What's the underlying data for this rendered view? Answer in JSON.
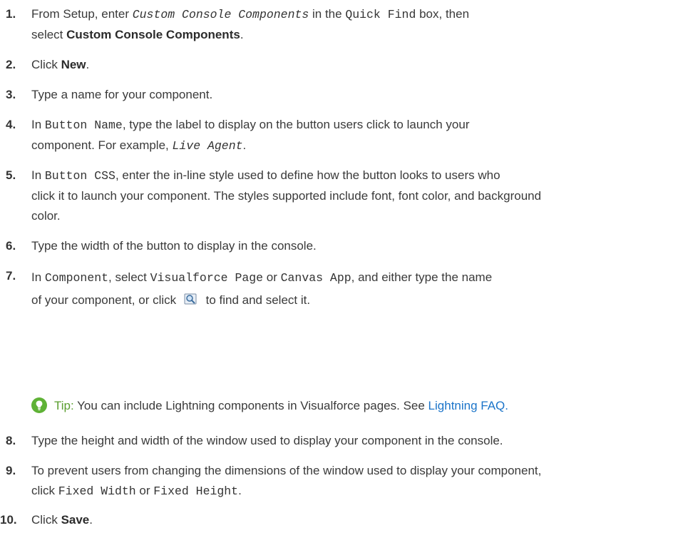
{
  "steps": [
    {
      "num": "1.",
      "a": "From Setup, enter ",
      "c1": "Custom Console Components",
      "b": " in the ",
      "c2": "Quick Find",
      "d": " box, then",
      "line2a": "select ",
      "bold": "Custom Console Components",
      "line2b": "."
    },
    {
      "num": "2.",
      "a": "Click ",
      "bold": "New",
      "b": "."
    },
    {
      "num": "3.",
      "a": "Type a name for your component."
    },
    {
      "num": "4.",
      "a": "In ",
      "c1": "Button Name",
      "b": ", type the label to display on the button users click to launch your",
      "line2a": "component. For example, ",
      "c2": "Live Agent",
      "line2b": "."
    },
    {
      "num": "5.",
      "a": "In ",
      "c1": "Button CSS",
      "b": ", enter the in-line style used to define how the button looks to users who",
      "line2": "click it to launch your component. The styles supported include font, font color, and background",
      "line3": "color."
    },
    {
      "num": "6.",
      "a": "Type the width of the button to display in the console."
    },
    {
      "num": "7.",
      "a": "In ",
      "c1": "Component",
      "b": ", select ",
      "c2": "Visualforce Page",
      "c": " or ",
      "c3": "Canvas App",
      "d": ", and either type the name",
      "line2a": "of your component, or click ",
      "line2b": " to find and select it."
    },
    {
      "num": "8.",
      "a": "Type the height and width of the window used to display your component in the console."
    },
    {
      "num": "9.",
      "a": "To prevent users from changing the dimensions of the window used to display your component,",
      "line2a": "click ",
      "c1": "Fixed Width",
      "line2b": " or ",
      "c2": "Fixed Height",
      "line2c": "."
    },
    {
      "num": "10.",
      "a": "Click ",
      "bold": "Save",
      "b": "."
    }
  ],
  "tip": {
    "label": "Tip:",
    "text": " You can include Lightning components in Visualforce pages. See ",
    "link": "Lightning FAQ",
    "end": "."
  },
  "icons": {
    "lookup": "lookup-magnifier-icon",
    "tip": "lightbulb-icon"
  },
  "colors": {
    "tip_green": "#5a9e2f",
    "link_blue": "#1b74c9"
  }
}
